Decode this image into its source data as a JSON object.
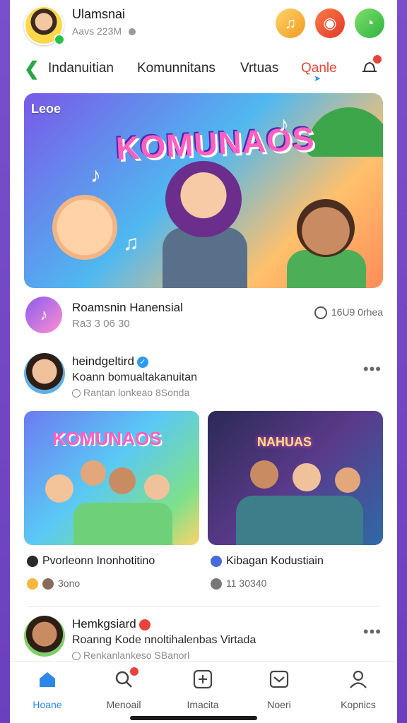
{
  "header": {
    "user_name": "Ulamsnai",
    "user_status": "Aavs 223M",
    "icons": [
      "music-icon",
      "camera-icon",
      "clock-icon"
    ]
  },
  "tabs": [
    {
      "label": "Indanuitian"
    },
    {
      "label": "Komunnitans"
    },
    {
      "label": "Vrtuas"
    },
    {
      "label": "Qanle",
      "active": true
    }
  ],
  "banner": {
    "logo": "Leoe",
    "title": "KOMUNAOS"
  },
  "channel": {
    "name": "Roamsnin Hanensial",
    "sub": "Ra3 3 06 30",
    "meta": "16U9 0rhea"
  },
  "posts": [
    {
      "name": "heindgeltird",
      "text": "Koann bomualtakanuitan",
      "sub": "Rantan lonkeao 8Sonda"
    },
    {
      "name": "Hemkgsiard",
      "text": "Roanng Kode nnoltihalenbas Virtada",
      "sub": "Renkanlankeso SBanorl"
    }
  ],
  "cards": [
    {
      "title": "KOMUNAOS",
      "caption": "Pvorleonn Inonhotitino",
      "meta": "3ono"
    },
    {
      "title": "NAHUAS",
      "caption": "Kibagan Kodustiain",
      "meta": "11 30340"
    }
  ],
  "nav": [
    {
      "label": "Hoane",
      "icon": "home-icon",
      "active": true
    },
    {
      "label": "Menoail",
      "icon": "search-icon"
    },
    {
      "label": "Imacita",
      "icon": "add-icon"
    },
    {
      "label": "Noeri",
      "icon": "inbox-icon"
    },
    {
      "label": "Kopnics",
      "icon": "profile-icon"
    }
  ],
  "colors": {
    "accent_blue": "#2d88e8",
    "accent_red": "#e8443a",
    "frame_purple": "#7b4fc9"
  }
}
